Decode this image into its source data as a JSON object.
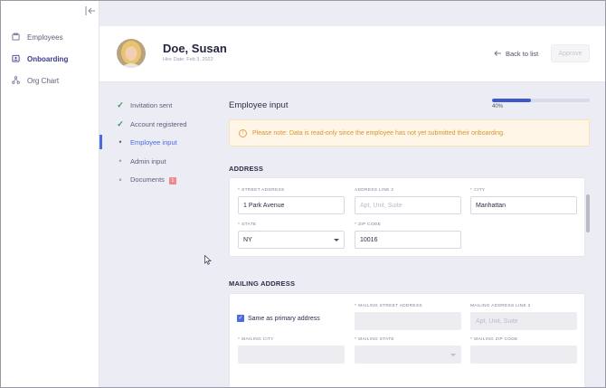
{
  "sidebar": {
    "collapse_icon": "collapse-left-icon",
    "items": [
      {
        "label": "Employees",
        "icon": "employees-icon"
      },
      {
        "label": "Onboarding",
        "icon": "onboarding-icon",
        "active": true
      },
      {
        "label": "Org Chart",
        "icon": "org-chart-icon"
      }
    ]
  },
  "header": {
    "name": "Doe, Susan",
    "hire_date": "Hire Date: Feb 3, 2022",
    "back_label": "Back to list",
    "approve_label": "Approve"
  },
  "steps": [
    {
      "label": "Invitation sent",
      "state": "done"
    },
    {
      "label": "Account registered",
      "state": "done"
    },
    {
      "label": "Employee input",
      "state": "current"
    },
    {
      "label": "Admin input",
      "state": "pending"
    },
    {
      "label": "Documents",
      "state": "pending",
      "badge": "1"
    }
  ],
  "main": {
    "title": "Employee input",
    "progress_percent": 40,
    "progress_label": "40%",
    "notice": "Please note: Data is read-only since the employee has not yet submitted their onboarding.",
    "address": {
      "title": "ADDRESS",
      "street_label": "STREET ADDRESS",
      "street_value": "1 Park Avenue",
      "line2_label": "ADDRESS LINE 2",
      "line2_placeholder": "Apt, Unit, Suite",
      "city_label": "CITY",
      "city_value": "Manhattan",
      "state_label": "STATE",
      "state_value": "NY",
      "zip_label": "ZIP CODE",
      "zip_value": "10016"
    },
    "mailing": {
      "title": "MAILING ADDRESS",
      "same_label": "Same as primary address",
      "street_label": "MAILING STREET ADDRESS",
      "line2_label": "MAILING ADDRESS LINE 2",
      "line2_placeholder": "Apt, Unit, Suite",
      "city_label": "MAILING CITY",
      "state_label": "MAILING STATE",
      "zip_label": "MAILING ZIP CODE"
    }
  },
  "colors": {
    "accent": "#4a6be0",
    "done": "#2a9d55",
    "notice_text": "#d9932f",
    "notice_bg": "#fff6e7"
  }
}
